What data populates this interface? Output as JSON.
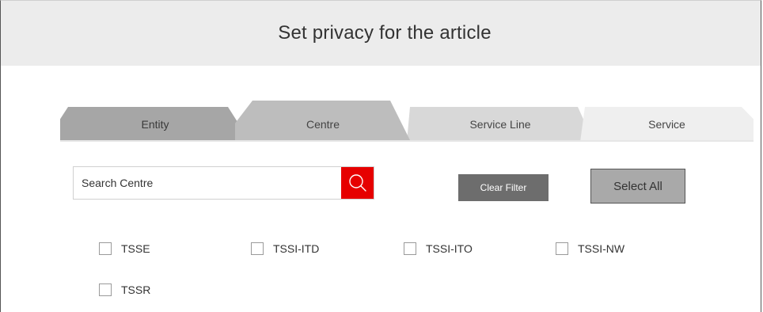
{
  "header": {
    "title": "Set privacy for the article"
  },
  "tabs": [
    {
      "label": "Entity"
    },
    {
      "label": "Centre",
      "active": true
    },
    {
      "label": "Service Line"
    },
    {
      "label": "Service"
    }
  ],
  "search": {
    "placeholder": "Search Centre",
    "value": "",
    "icon": "search-icon"
  },
  "actions": {
    "clear_filter_label": "Clear Filter",
    "select_all_label": "Select All"
  },
  "options": [
    {
      "label": "TSSE",
      "checked": false
    },
    {
      "label": "TSSI-ITD",
      "checked": false
    },
    {
      "label": "TSSI-ITO",
      "checked": false
    },
    {
      "label": "TSSI-NW",
      "checked": false
    },
    {
      "label": "TSSR",
      "checked": false
    }
  ],
  "colors": {
    "accent": "#e60000",
    "header_bg": "#ececec",
    "clear_filter_bg": "#6d6d6d",
    "select_all_bg": "#a9a9a9"
  }
}
